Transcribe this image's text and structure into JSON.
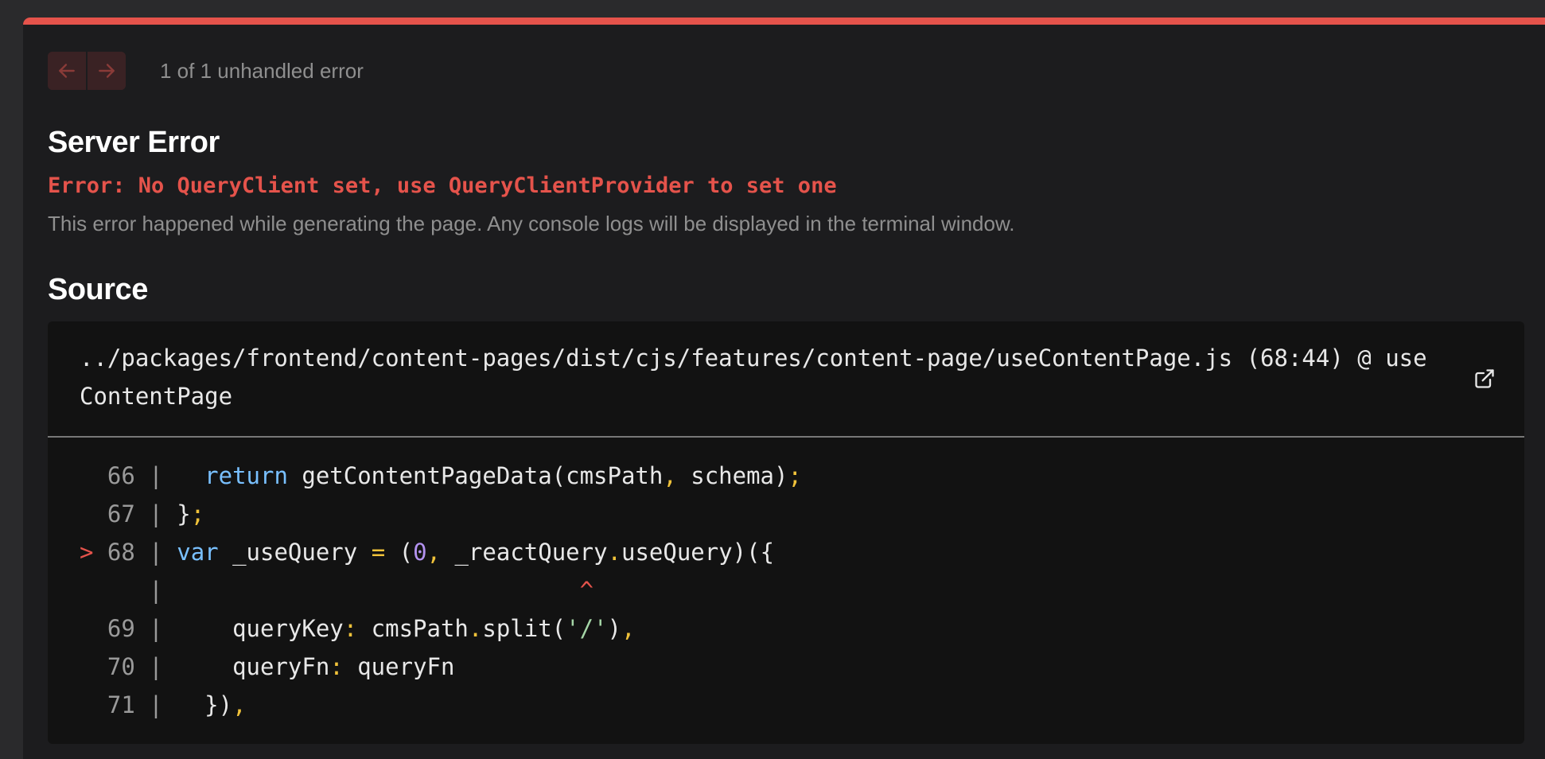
{
  "colors": {
    "accent_red": "#e5534b",
    "background": "#1c1c1e",
    "code_background": "#121212",
    "keyword": "#79c0ff",
    "punctuation": "#f0c23a",
    "number": "#b392f0",
    "string": "#a5d6a7"
  },
  "nav": {
    "prev_icon": "arrow-left-icon",
    "next_icon": "arrow-right-icon",
    "count_text": "1 of 1 unhandled error"
  },
  "error": {
    "title": "Server Error",
    "message": "Error: No QueryClient set, use QueryClientProvider to set one",
    "description": "This error happened while generating the page. Any console logs will be displayed in the terminal window."
  },
  "source": {
    "section_title": "Source",
    "file_path": "../packages/frontend/content-pages/dist/cjs/features/content-page/useContentPage.js (68:44) @ useContentPage",
    "open_icon": "external-link-icon",
    "highlighted_line": 68,
    "lines": [
      {
        "marker": " ",
        "number": "66",
        "tokens": [
          [
            "plain",
            "  "
          ],
          [
            "kw",
            "return"
          ],
          [
            "plain",
            " getContentPageData(cmsPath"
          ],
          [
            "punct",
            ","
          ],
          [
            "plain",
            " schema)"
          ],
          [
            "punct",
            ";"
          ]
        ]
      },
      {
        "marker": " ",
        "number": "67",
        "tokens": [
          [
            "plain",
            "}"
          ],
          [
            "punct",
            ";"
          ]
        ]
      },
      {
        "marker": ">",
        "number": "68",
        "tokens": [
          [
            "kw",
            "var"
          ],
          [
            "plain",
            " _useQuery "
          ],
          [
            "punct",
            "="
          ],
          [
            "plain",
            " ("
          ],
          [
            "num",
            "0"
          ],
          [
            "punct",
            ","
          ],
          [
            "plain",
            " _reactQuery"
          ],
          [
            "punct",
            "."
          ],
          [
            "plain",
            "useQuery)({"
          ]
        ]
      },
      {
        "marker": " ",
        "number": "  ",
        "tokens": [
          [
            "plain",
            "                             "
          ],
          [
            "caret",
            "^"
          ]
        ]
      },
      {
        "marker": " ",
        "number": "69",
        "tokens": [
          [
            "plain",
            "    queryKey"
          ],
          [
            "punct",
            ":"
          ],
          [
            "plain",
            " cmsPath"
          ],
          [
            "punct",
            "."
          ],
          [
            "plain",
            "split("
          ],
          [
            "str",
            "'/'"
          ],
          [
            "plain",
            ")"
          ],
          [
            "punct",
            ","
          ]
        ]
      },
      {
        "marker": " ",
        "number": "70",
        "tokens": [
          [
            "plain",
            "    queryFn"
          ],
          [
            "punct",
            ":"
          ],
          [
            "plain",
            " queryFn"
          ]
        ]
      },
      {
        "marker": " ",
        "number": "71",
        "tokens": [
          [
            "plain",
            "  })"
          ],
          [
            "punct",
            ","
          ]
        ]
      }
    ]
  }
}
